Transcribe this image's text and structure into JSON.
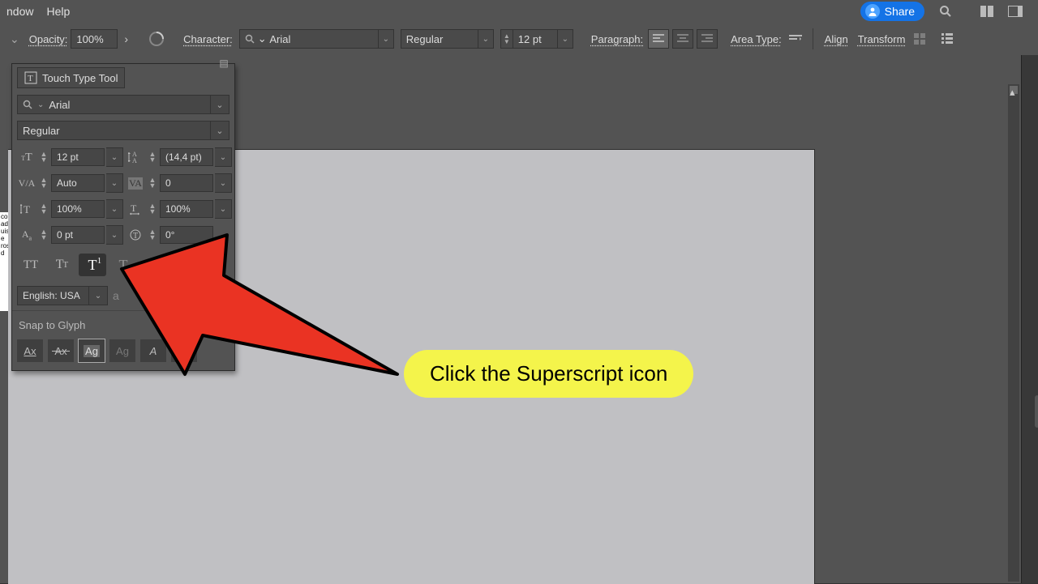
{
  "menu": {
    "window": "ndow",
    "help": "Help",
    "share": "Share"
  },
  "controlbar": {
    "opacity_label": "Opacity:",
    "opacity_value": "100%",
    "character_label": "Character:",
    "font_search_placeholder": "Arial",
    "font_value": "Arial",
    "weight_value": "Regular",
    "size_value": "12 pt",
    "paragraph_label": "Paragraph:",
    "areatype_label": "Area Type:",
    "align": "Align",
    "transform": "Transform"
  },
  "panel": {
    "touch_type": "Touch Type Tool",
    "font_value": "Arial",
    "weight_value": "Regular",
    "metrics": {
      "size": "12 pt",
      "leading": "(14,4 pt)",
      "kerning": "Auto",
      "tracking": "0",
      "vscale": "100%",
      "hscale": "100%",
      "baseline": "0 pt",
      "rotate": "0°"
    },
    "icons": {
      "size": "font-size-icon",
      "leading": "leading-icon",
      "kerning": "kerning-icon",
      "tracking": "tracking-icon",
      "vscale": "vertical-scale-icon",
      "hscale": "horizontal-scale-icon",
      "baseline": "baseline-shift-icon",
      "rotate": "char-rotate-icon"
    },
    "language": "English: USA",
    "aa_hint": "a",
    "snap_label": "Snap to Glyph",
    "style_buttons": {
      "allcaps": "TT",
      "smallcaps": "Tᴛ",
      "superscript": "T",
      "subscript": "T"
    },
    "snap_buttons": [
      "Ax",
      "Ax",
      "Ag",
      "Ag",
      "A",
      "A"
    ]
  },
  "callout": "Click the Superscript icon",
  "colors": {
    "accent": "#1473e6",
    "panel": "#535353",
    "arrow": "#ea3323",
    "callout_bg": "#f4f44b"
  }
}
